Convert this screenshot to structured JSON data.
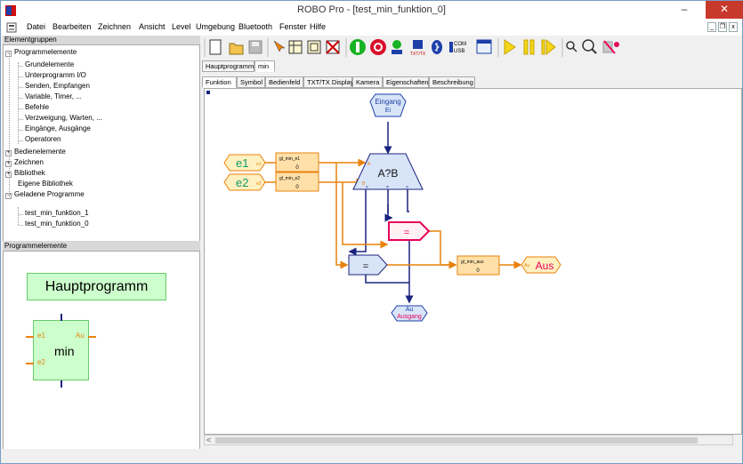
{
  "window": {
    "title": "ROBO Pro - [test_min_funktion_0]",
    "minimize_glyph": "–",
    "maximize_glyph": "□",
    "close_glyph": "✕"
  },
  "menu": {
    "datei": "Datei",
    "bearbeiten": "Bearbeiten",
    "zeichnen": "Zeichnen",
    "ansicht": "Ansicht",
    "level": "Level",
    "umgebung": "Umgebung",
    "bluetooth": "Bluetooth",
    "fenster": "Fenster",
    "hilfe": "Hilfe",
    "mdi_min": "_",
    "mdi_restore": "❐",
    "mdi_close": "x"
  },
  "left_panel": {
    "header": "Elementgruppen",
    "tree": {
      "programmelemente": "Programmelemente",
      "grundelemente": "Grundelemente",
      "unterprogramm": "Unterprogramm I/O",
      "senden": "Senden, Empfangen",
      "variable": "Variable, Timer, ...",
      "befehle": "Befehle",
      "verzweigung": "Verzweigung, Warten, ...",
      "eingaenge": "Eingänge, Ausgänge",
      "operatoren": "Operatoren",
      "bedienelemente": "Bedienelemente",
      "zeichnen": "Zeichnen",
      "bibliothek": "Bibliothek",
      "eigene_bibliothek": "Eigene Bibliothek",
      "geladene_programme": "Geladene Programme",
      "prog1": "test_min_funktion_1",
      "prog2": "test_min_funktion_0",
      "box_minus": "−",
      "box_plus": "+"
    },
    "elements_header": "Programmelemente",
    "hauptprogramm": "Hauptprogramm",
    "min_block": {
      "label": "min",
      "in1": "e1",
      "in2": "e2",
      "out": "Au"
    }
  },
  "program_tabs": [
    "Hauptprogramm",
    "min"
  ],
  "view_tabs": [
    "Funktion",
    "Symbol",
    "Bedienfeld",
    "TXT/TX Display",
    "Kamera",
    "Eigenschaften",
    "Beschreibung"
  ],
  "diagram": {
    "input_block": {
      "line1": "Eingang",
      "line2": "Ei"
    },
    "output_block": {
      "line1": "Au",
      "line2": "Ausgang"
    },
    "e1": {
      "label": "e1",
      "port": "e1"
    },
    "e2": {
      "label": "e2",
      "port": "e2"
    },
    "var1": {
      "name": "gl_min_e1",
      "value": "0"
    },
    "var2": {
      "name": "gl_min_e2",
      "value": "0"
    },
    "compare": {
      "label": "A?B",
      "in_a": "A",
      "in_b": "B",
      "out_lt": "<",
      "out_eq": "=",
      "out_gt": ">"
    },
    "assign1": {
      "label": "="
    },
    "assign2": {
      "label": "="
    },
    "var_out": {
      "name": "gl_min_aus",
      "value": "0"
    },
    "aus": {
      "label": "Aus",
      "port": "Au"
    },
    "colors": {
      "orange": "#e8820c",
      "navy": "#1a237e",
      "pink": "#e8005a",
      "var_fill": "#ffe0a8",
      "blue_fill": "#d8e4f8",
      "io_fill": "#fff0c0"
    }
  },
  "scroll": {
    "left_arrow": "<"
  }
}
